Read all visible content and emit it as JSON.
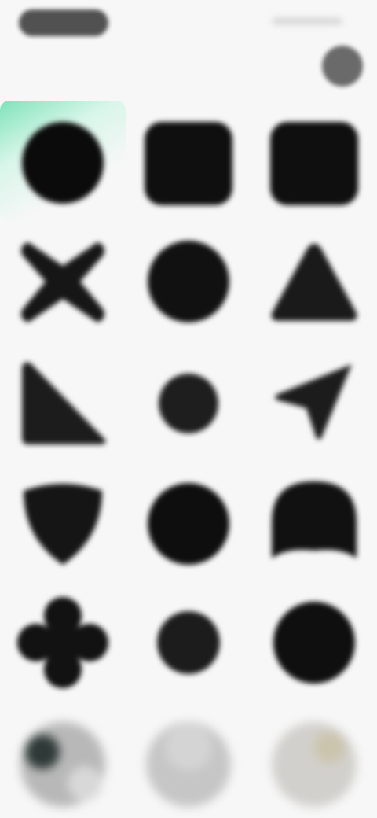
{
  "header": {
    "title": "",
    "status_pill_icon": "status-pill",
    "avatar_icon": "profile-avatar"
  },
  "grid": {
    "selected_index": 0,
    "items": [
      {
        "shape": "circle",
        "label": ""
      },
      {
        "shape": "rounded-square",
        "label": ""
      },
      {
        "shape": "rounded-square",
        "label": ""
      },
      {
        "shape": "x-cross",
        "label": ""
      },
      {
        "shape": "circle",
        "label": ""
      },
      {
        "shape": "triangle",
        "label": ""
      },
      {
        "shape": "right-triangle",
        "label": ""
      },
      {
        "shape": "small-circle",
        "label": ""
      },
      {
        "shape": "arrow-pointer",
        "label": ""
      },
      {
        "shape": "shield",
        "label": ""
      },
      {
        "shape": "circle",
        "label": ""
      },
      {
        "shape": "arch",
        "label": ""
      },
      {
        "shape": "flower",
        "label": ""
      },
      {
        "shape": "small-circle",
        "label": ""
      },
      {
        "shape": "circle",
        "label": ""
      },
      {
        "shape": "photo-thumbnail",
        "label": ""
      },
      {
        "shape": "photo-thumbnail",
        "label": ""
      },
      {
        "shape": "photo-thumbnail",
        "label": ""
      }
    ]
  },
  "colors": {
    "background": "#f7f7f7",
    "shape_fill": "#121212",
    "selected_accent": "#7fe3b9"
  }
}
